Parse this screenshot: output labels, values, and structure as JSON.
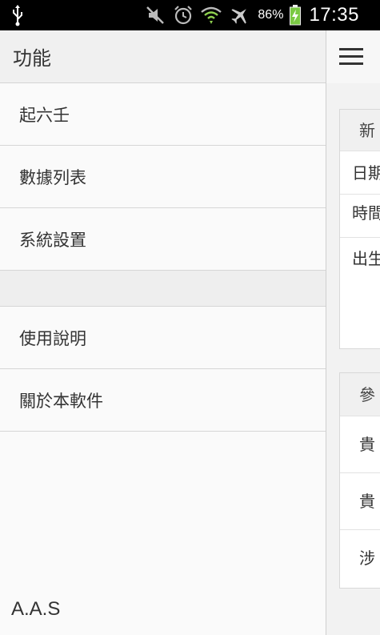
{
  "status_bar": {
    "battery_percent": "86%",
    "time": "17:35",
    "icons": [
      "usb-icon",
      "mute-icon",
      "alarm-icon",
      "wifi-icon",
      "airplane-icon",
      "battery-charging-icon"
    ]
  },
  "drawer": {
    "title": "功能",
    "items": [
      {
        "label": "起六壬"
      },
      {
        "label": "數據列表"
      },
      {
        "label": "系統設置"
      },
      {
        "label": ""
      },
      {
        "label": "使用說明"
      },
      {
        "label": "關於本軟件"
      }
    ],
    "footer": "A.A.S"
  },
  "main": {
    "card1": {
      "header": "新",
      "rows": [
        "日期",
        "時間",
        "出生"
      ]
    },
    "card2": {
      "header": "參",
      "rows": [
        "貴",
        "貴",
        "涉"
      ]
    }
  },
  "colors": {
    "status_bar_bg": "#000000",
    "drawer_bg": "#fafafa",
    "header_bg": "#f0f0f0",
    "battery_green": "#7ac943"
  }
}
